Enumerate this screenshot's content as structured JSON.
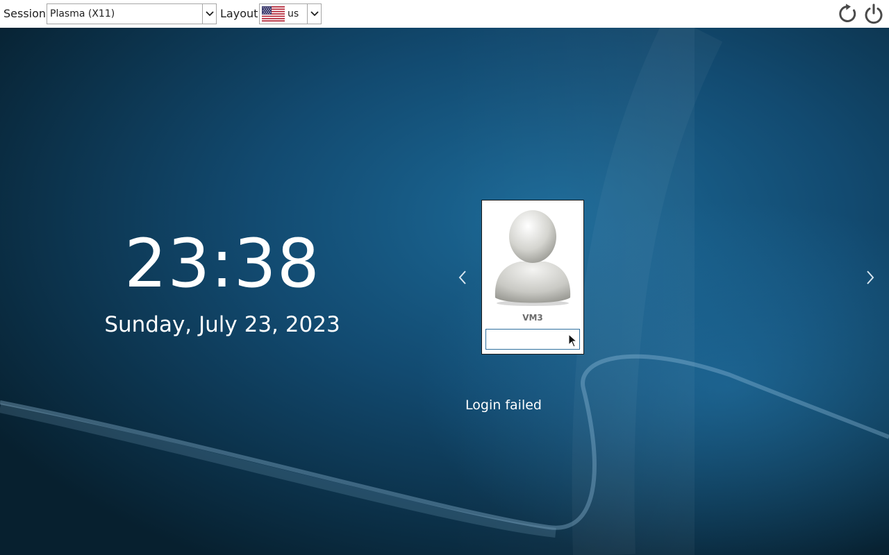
{
  "topbar": {
    "session_label": "Session",
    "session_value": "Plasma (X11)",
    "layout_label": "Layout",
    "layout_value": "us",
    "layout_flag_icon": "us-flag-icon",
    "reboot_icon": "reboot-icon",
    "shutdown_icon": "power-icon"
  },
  "clock": {
    "time": "23:38",
    "date": "Sunday, July 23, 2023"
  },
  "user": {
    "name": "VM3",
    "avatar_icon": "user-avatar-icon",
    "password_value": ""
  },
  "navigation": {
    "prev_icon": "chevron-left-icon",
    "next_icon": "chevron-right-icon"
  },
  "status": {
    "message": "Login failed"
  },
  "colors": {
    "background_dark": "#081f30",
    "background_light": "#1f6a96",
    "topbar": "#ffffff",
    "text_light": "#ffffff"
  }
}
